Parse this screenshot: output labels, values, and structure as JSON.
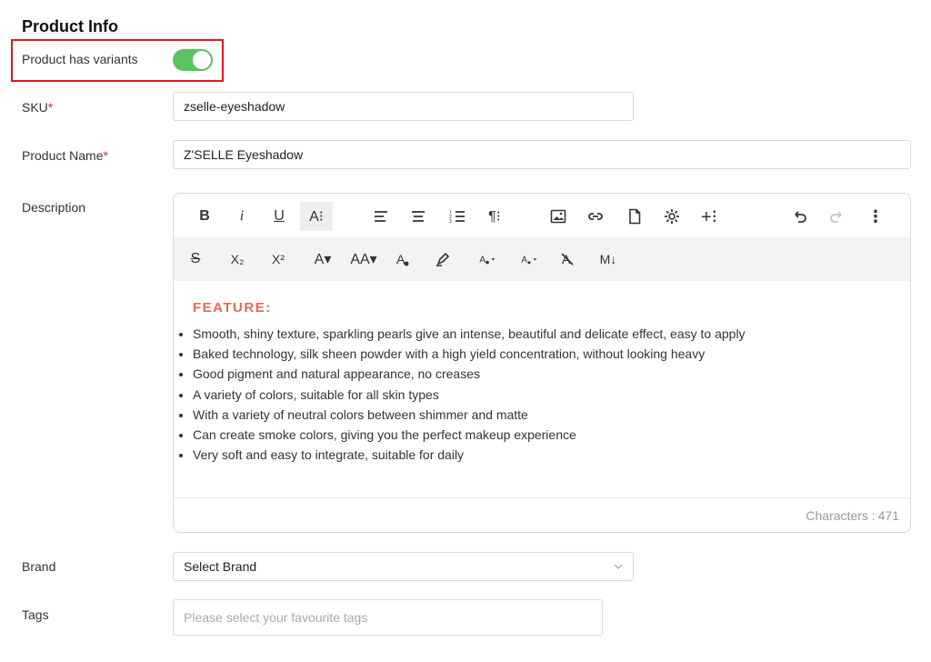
{
  "section_title": "Product Info",
  "variants": {
    "label": "Product has variants",
    "enabled": true
  },
  "sku": {
    "label": "SKU",
    "required_mark": "*",
    "value": "zselle-eyeshadow"
  },
  "product_name": {
    "label": "Product Name",
    "required_mark": "*",
    "value": "Z'SELLE Eyeshadow"
  },
  "description": {
    "label": "Description",
    "heading": "FEATURE:",
    "bullets": [
      "Smooth, shiny texture, sparkling pearls give an intense, beautiful and delicate effect, easy to apply",
      "Baked technology, silk sheen powder with a high yield concentration, without looking heavy",
      "Good pigment and natural appearance, no creases",
      "A variety of colors, suitable for all skin types",
      "With a variety of neutral colors between shimmer and matte",
      "Can create smoke colors, giving you the perfect makeup experience",
      "Very soft and easy to integrate, suitable for daily"
    ],
    "char_label": "Characters :",
    "char_count": "471"
  },
  "toolbar": {
    "bold": "B",
    "italic": "i",
    "underline": "U",
    "more_text": "A⁝",
    "strike": "S",
    "subscript": "X₂",
    "superscript": "X²",
    "font_color": "A▾",
    "font_size": "AA▾",
    "text_color": "A",
    "paragraph_format": "¶⁝",
    "insert_more": "+⁝",
    "more_misc": "⋮",
    "markdown": "M↓"
  },
  "brand": {
    "label": "Brand",
    "value": "Select Brand"
  },
  "tags": {
    "label": "Tags",
    "placeholder": "Please select your favourite tags"
  },
  "colors": {
    "toggle_on": "#5cc45f",
    "required": "#d6282b",
    "feature_heading": "#e06c4e",
    "highlight": "#e8121a"
  }
}
